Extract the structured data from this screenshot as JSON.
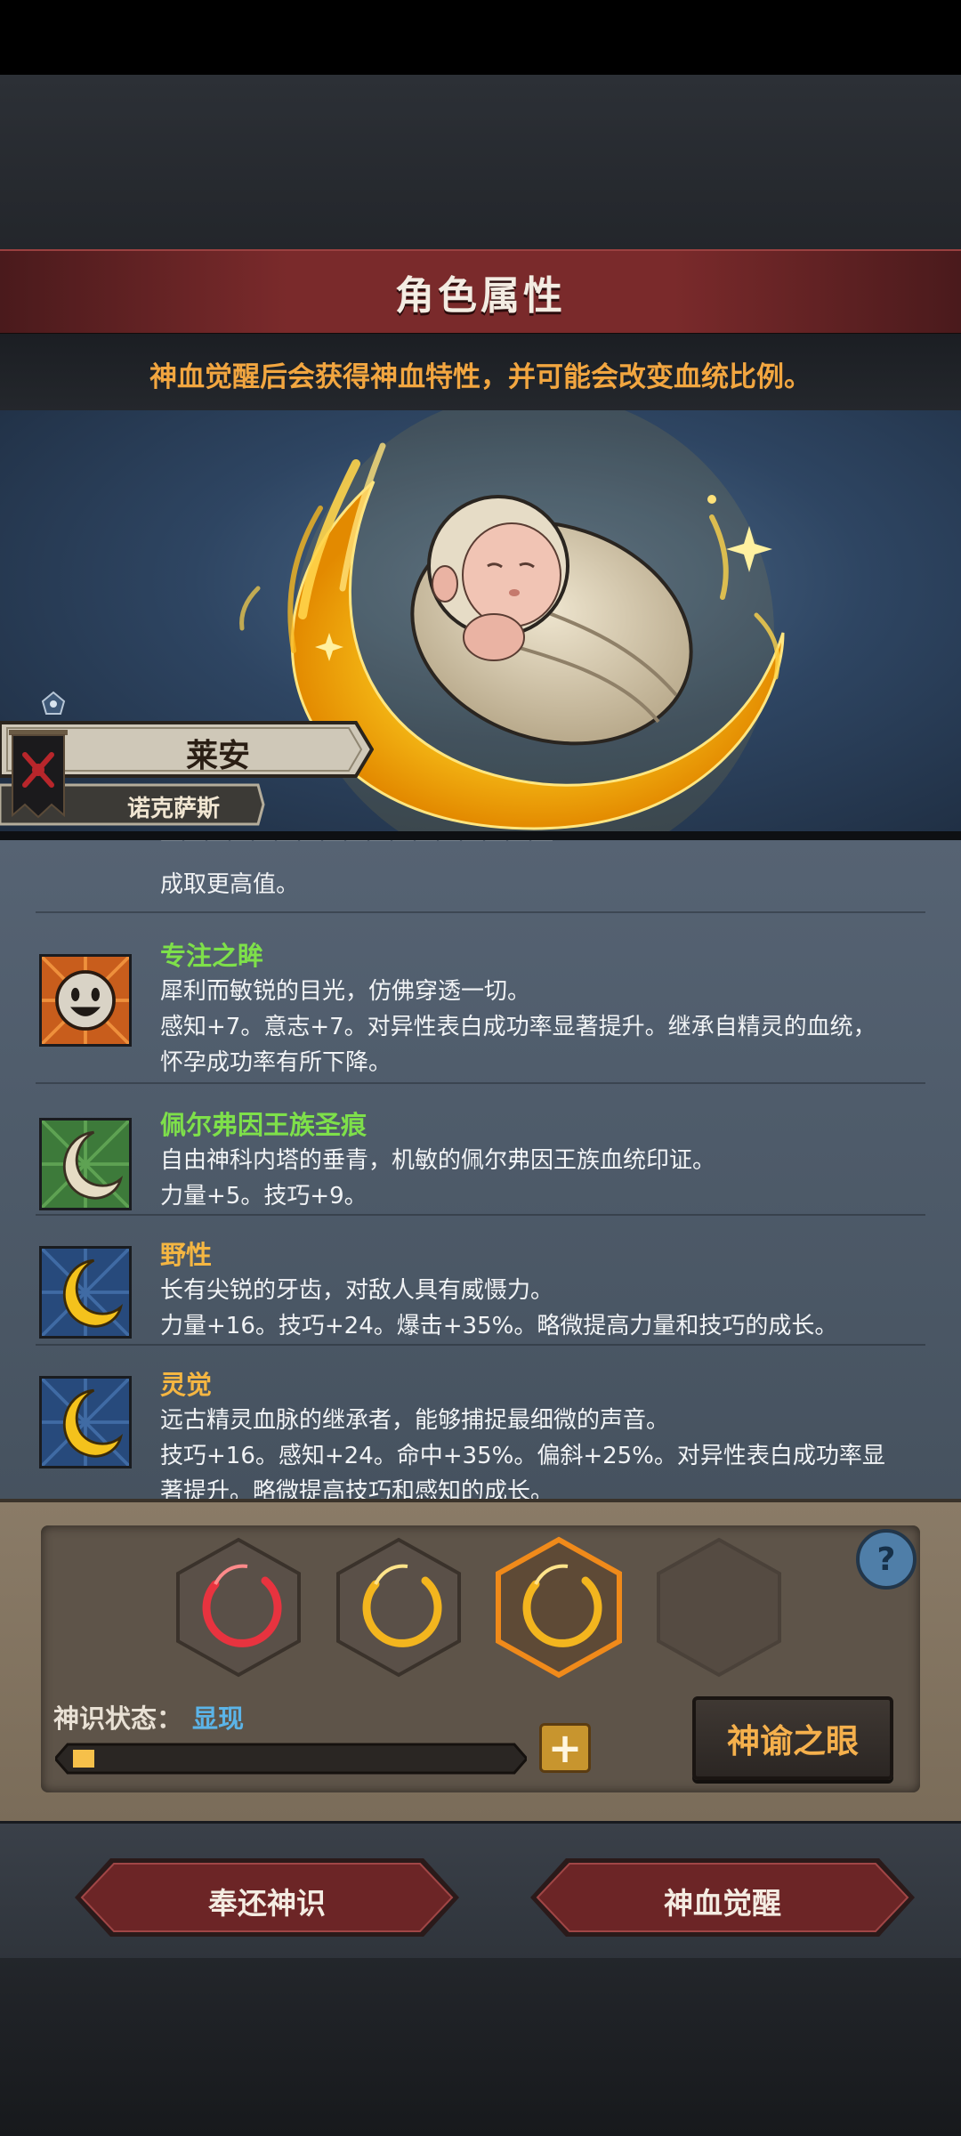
{
  "header": {
    "title": "角色属性",
    "hint": "神血觉醒后会获得神血特性，并可能会改变血统比例。"
  },
  "character": {
    "name": "莱安",
    "house": "诺克萨斯"
  },
  "traits": {
    "partial_text": "成取更高值。",
    "items": [
      {
        "name": "专注之眸",
        "name_color": "#7ee04a",
        "icon": "smiley-face-icon",
        "desc1": "犀利而敏锐的目光，仿佛穿透一切。",
        "desc2": "感知+7。意志+7。对异性表白成功率显著提升。继承自精灵的血统，",
        "desc3": "怀孕成功率有所下降。"
      },
      {
        "name": "佩尔弗因王族圣痕",
        "name_color": "#7ee04a",
        "icon": "white-crescent-icon",
        "desc1": "自由神科内塔的垂青，机敏的佩尔弗因王族血统印证。",
        "desc2": "力量+5。技巧+9。"
      },
      {
        "name": "野性",
        "name_color": "#f5b642",
        "icon": "gold-crescent-icon",
        "desc1": "长有尖锐的牙齿，对敌人具有威慑力。",
        "desc2": "力量+16。技巧+24。爆击+35%。略微提高力量和技巧的成长。"
      },
      {
        "name": "灵觉",
        "name_color": "#f5b642",
        "icon": "gold-crescent-icon",
        "desc1": "远古精灵血脉的继承者，能够捕捉最细微的声音。",
        "desc2": "技巧+16。感知+24。命中+35%。偏斜+25%。对异性表白成功率显",
        "desc3": "著提升。略微提高技巧和感知的成长。"
      }
    ]
  },
  "divine": {
    "status_label": "神识状态：",
    "status_value": "显现",
    "progress": 0.04,
    "slots": [
      "red",
      "gold",
      "gold-selected",
      "empty"
    ],
    "help": "?",
    "plus": "+",
    "oracle_button": "神谕之眼"
  },
  "footer": {
    "return_button": "奉还神识",
    "awaken_button": "神血觉醒"
  },
  "colors": {
    "accent_gold": "#f2a640",
    "status_blue": "#5bb4e8",
    "banner_red": "#7a2a2b"
  }
}
